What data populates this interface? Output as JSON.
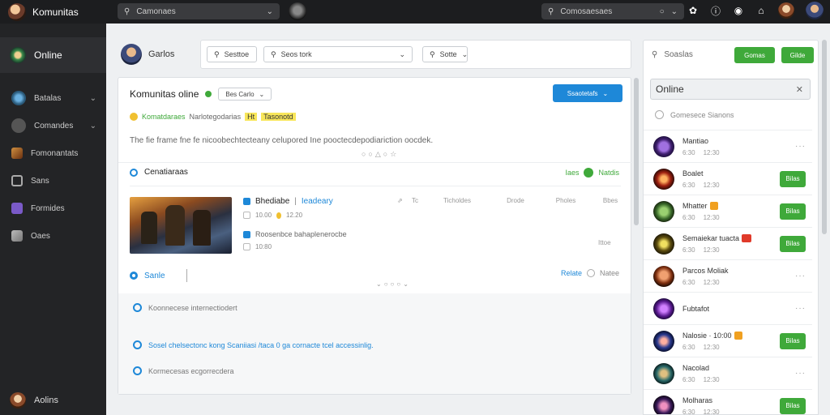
{
  "topbar": {
    "brand": "Komunitas",
    "search_placeholder": "Camonaes",
    "search2_placeholder": "Comosaesaes"
  },
  "sidebar": {
    "online_label": "Online",
    "items": [
      {
        "label": "Batalas",
        "icon": "globe-icon"
      },
      {
        "label": "Comandes",
        "icon": "gamepad-icon"
      },
      {
        "label": "Fomonantats",
        "icon": "grid-icon"
      },
      {
        "label": "Sans",
        "icon": "camera-icon"
      },
      {
        "label": "Formides",
        "icon": "puzzle-icon"
      },
      {
        "label": "Oaes",
        "icon": "image-icon"
      }
    ],
    "bottom_label": "Aolins"
  },
  "header": {
    "user": "Garlos",
    "search_btn": "Sesttoe",
    "search_field": "Seos tork",
    "filter_btn": "Sotte"
  },
  "community": {
    "title": "Komunitas oline",
    "dropdown": "Bes Carlo",
    "action_btn": "Ssaotetafs",
    "tagline_green": "Komatdaraes",
    "tagline_rest": "Narlotegodarias",
    "tagline_tag": "Ht",
    "tagline_badge": "Tasonotd",
    "description": "The fie frame fne fe nicoobechtecteany celupored Ine pooctecdepodiariction oocdek.",
    "section_title": "Cenatiaraas",
    "section_right_green": "Iaes",
    "section_right_label": "Natdis",
    "post": {
      "title": "Bhediabe",
      "sep": "Ieadeary",
      "meta": "10.00",
      "meta2": "12.20",
      "cols": [
        "Tc",
        "Ticholdes",
        "Drode",
        "Pholes",
        "Bbes"
      ],
      "line2": "Roosenbce bahaplenerocbe",
      "line2_meta": "10:80",
      "line2_right": "Ittoe"
    },
    "reply_label": "Sanle",
    "reply_right_blue": "Relate",
    "reply_right": "Natee",
    "notes": [
      "Koonnecese internectiodert",
      "Sosel chelsectonc kong Scaniiasi /taca 0 ga cornacte tcel accessinlig.",
      "Kormecesas ecgorrecdera"
    ]
  },
  "friends": {
    "search": "Soaslas",
    "btn1": "Gomas",
    "btn2": "Gilde",
    "online_title": "Online",
    "subtitle": "Gomesece Sianons",
    "list": [
      {
        "name": "Mantiao",
        "meta1": "6:30",
        "meta2": "12:30",
        "action": "dots",
        "avatar": "av-game"
      },
      {
        "name": "Boalet",
        "meta1": "6:30",
        "meta2": "12:30",
        "action": "button",
        "avatar": "av-red"
      },
      {
        "name": "Mhatter",
        "meta1": "6:30",
        "meta2": "12:30",
        "action": "button",
        "avatar": "av-green",
        "badge": "orange"
      },
      {
        "name": "Semaiekar tuacta",
        "meta1": "6:30",
        "meta2": "12:30",
        "action": "button",
        "avatar": "av-yellow",
        "badge": "red"
      },
      {
        "name": "Parcos Moliak",
        "meta1": "6:30",
        "meta2": "12:30",
        "action": "dots",
        "avatar": "av-orange"
      },
      {
        "name": "Fubtafot",
        "meta1": "",
        "meta2": "",
        "action": "dots",
        "avatar": "av-purple"
      },
      {
        "name": "Nalosie · 10:00",
        "meta1": "6:30",
        "meta2": "12:30",
        "action": "button",
        "avatar": "av-blue",
        "badge": "orange"
      },
      {
        "name": "Nacolad",
        "meta1": "6:30",
        "meta2": "12:30",
        "action": "dots",
        "avatar": "av-teal"
      },
      {
        "name": "Molharas",
        "meta1": "6:30",
        "meta2": "12:30",
        "action": "button",
        "avatar": "av-dark"
      }
    ],
    "button_label": "Bilas"
  }
}
